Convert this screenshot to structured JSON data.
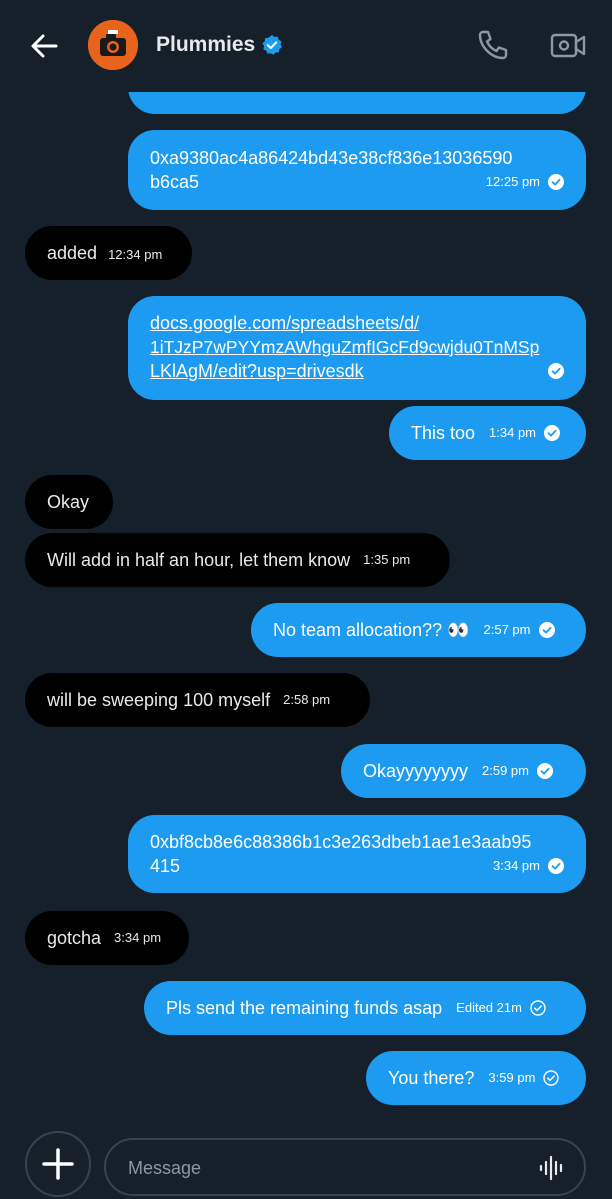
{
  "header": {
    "title": "Plummies",
    "accent": "#1d9bf0"
  },
  "messages": [
    {
      "text": "0xa9380ac4a86424bd43e38cf836e13036590b6ca5",
      "line1": "0xa9380ac4a86424bd43e38cf836e13036590",
      "line2": "b6ca5",
      "time": "12:25 pm",
      "direction": "sent"
    },
    {
      "text": "added",
      "time": "12:34 pm",
      "direction": "received"
    },
    {
      "line1": "docs.google.com/spreadsheets/d/",
      "line2": "1iTJzP7wPYYmzAWhguZmfIGcFd9cwjdu0TnMSp",
      "line3": "LKlAgM/edit?usp=drivesdk",
      "direction": "sent"
    },
    {
      "text": "This too",
      "time": "1:34 pm",
      "direction": "sent"
    },
    {
      "text": "Okay",
      "direction": "received"
    },
    {
      "text": "Will add in half an hour, let them know",
      "time": "1:35 pm",
      "direction": "received"
    },
    {
      "text": "No team allocation?? 👀",
      "time": "2:57 pm",
      "direction": "sent"
    },
    {
      "text": "will be sweeping 100 myself",
      "time": "2:58 pm",
      "direction": "received"
    },
    {
      "text": "Okayyyyyyyy",
      "time": "2:59 pm",
      "direction": "sent"
    },
    {
      "line1": "0xbf8cb8e6c88386b1c3e263dbeb1ae1e3aab95",
      "line2": "415",
      "time": "3:34 pm",
      "direction": "sent"
    },
    {
      "text": "gotcha",
      "time": "3:34 pm",
      "direction": "received"
    },
    {
      "text": "Pls send the remaining funds asap",
      "time": "Edited 21m",
      "direction": "sent"
    },
    {
      "text": "You there?",
      "time": "3:59 pm",
      "direction": "sent"
    }
  ],
  "composer": {
    "placeholder": "Message"
  },
  "colors": {
    "background": "#15202b",
    "sent_bubble": "#1d9bf0",
    "received_bubble": "#000000",
    "avatar_bg": "#e8631c"
  },
  "icons": {
    "back": "arrow-left-icon",
    "verified": "verified-badge-icon",
    "call": "phone-icon",
    "video": "video-camera-icon",
    "read": "check-circle-icon",
    "add": "plus-icon",
    "voice": "waveform-icon"
  }
}
